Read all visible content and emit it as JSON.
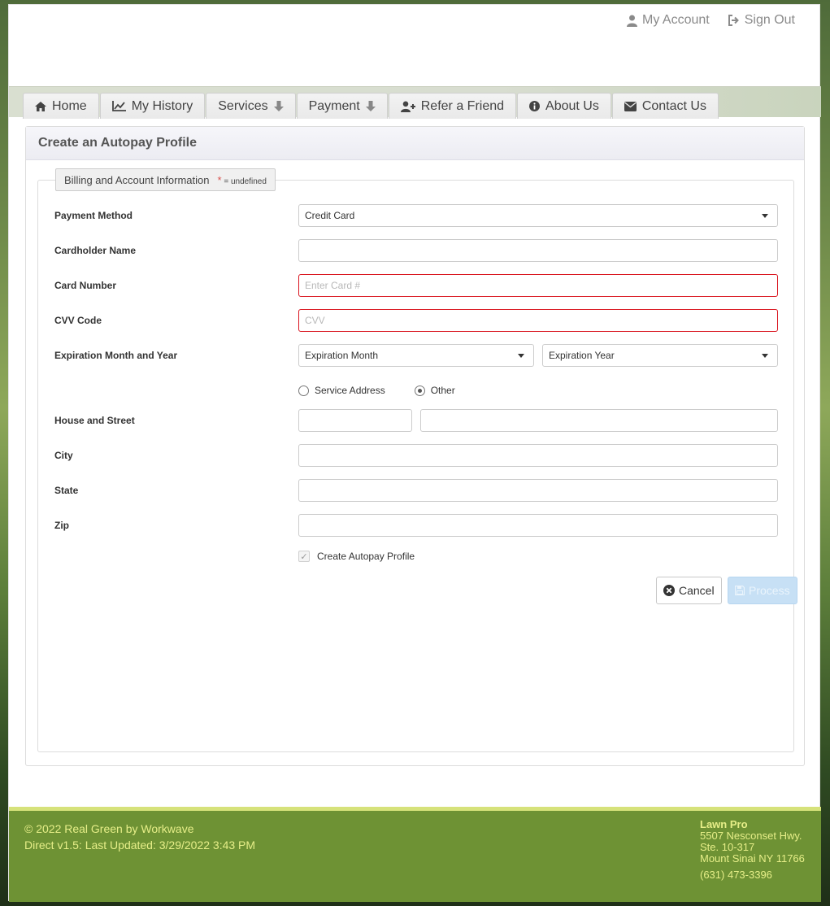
{
  "header": {
    "my_account": "My Account",
    "sign_out": "Sign Out"
  },
  "nav": {
    "tabs": [
      {
        "label": "Home",
        "icon": "home-icon"
      },
      {
        "label": "My History",
        "icon": "chart-line-icon"
      },
      {
        "label": "Services",
        "icon": "arrow-down-icon"
      },
      {
        "label": "Payment",
        "icon": "arrow-down-icon"
      },
      {
        "label": "Refer a Friend",
        "icon": "user-plus-icon"
      },
      {
        "label": "About Us",
        "icon": "info-circle-icon"
      },
      {
        "label": "Contact Us",
        "icon": "envelope-icon"
      }
    ]
  },
  "panel": {
    "title": "Create an Autopay Profile"
  },
  "form": {
    "legend": "Billing and Account Information",
    "required_star": "*",
    "required_note": "= undefined",
    "payment_method": {
      "label": "Payment Method",
      "value": "Credit Card"
    },
    "cardholder_name": {
      "label": "Cardholder Name",
      "value": ""
    },
    "card_number": {
      "label": "Card Number",
      "placeholder": "Enter Card #"
    },
    "cvv": {
      "label": "CVV Code",
      "placeholder": "CVV"
    },
    "expiration": {
      "label": "Expiration Month and Year",
      "month": "Expiration Month",
      "year": "Expiration Year"
    },
    "address_choice": {
      "option1": "Service Address",
      "option2": "Other",
      "selected": "Other"
    },
    "house_street": {
      "label": "House and Street"
    },
    "city": {
      "label": "City"
    },
    "state": {
      "label": "State"
    },
    "zip": {
      "label": "Zip"
    },
    "create_autopay": {
      "label": "Create Autopay Profile",
      "checked": true
    },
    "cancel_label": "Cancel",
    "process_label": "Process"
  },
  "footer": {
    "copyright": "© 2022 Real Green by Workwave",
    "version": "Direct v1.5: Last Updated: 3/29/2022 3:43 PM",
    "company": "Lawn Pro",
    "address1": "5507 Nesconset Hwy.",
    "address2": "Ste. 10-317",
    "address3": "Mount Sinai NY 11766",
    "phone": "(631) 473-3396"
  },
  "colors": {
    "footer_bg": "#6e9234",
    "footer_text": "#e6ee88",
    "error_border": "#d9141e",
    "process_button": "#c7e0f5"
  }
}
